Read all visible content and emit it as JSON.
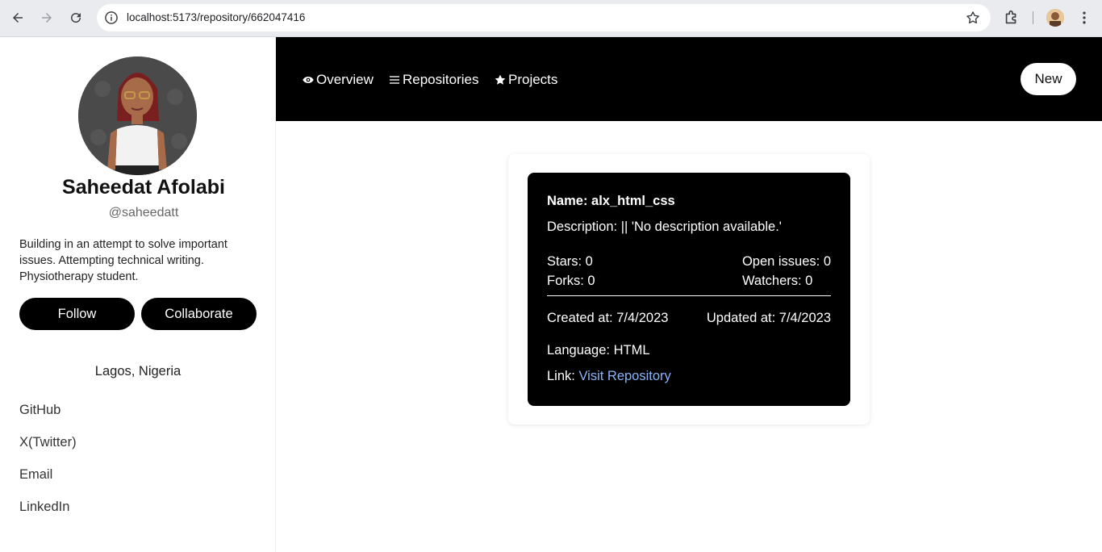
{
  "browser": {
    "url": "localhost:5173/repository/662047416"
  },
  "profile": {
    "name": "Saheedat Afolabi",
    "handle": "@saheedatt",
    "bio": "Building in an attempt to solve important issues. Attempting technical writing. Physiotherapy student.",
    "follow_label": "Follow",
    "collaborate_label": "Collaborate",
    "location": "Lagos, Nigeria",
    "links": [
      "GitHub",
      "X(Twitter)",
      "Email",
      "LinkedIn"
    ]
  },
  "nav": {
    "tabs": [
      {
        "label": "Overview",
        "icon": "eye-icon"
      },
      {
        "label": "Repositories",
        "icon": "list-icon"
      },
      {
        "label": "Projects",
        "icon": "star-icon"
      }
    ],
    "new_label": "New"
  },
  "repo": {
    "name": "Name: alx_html_css",
    "description": "Description: || 'No description available.'",
    "stars": "Stars: 0",
    "forks": "Forks: 0",
    "open_issues": "Open issues: 0",
    "watchers": "Watchers: 0",
    "created": "Created at: 7/4/2023",
    "updated": "Updated at: 7/4/2023",
    "language": "Language: HTML",
    "link_prefix": "Link:",
    "link_label": "Visit Repository"
  },
  "colors": {
    "accent_dark": "#000000",
    "link": "#8ab4f8"
  }
}
